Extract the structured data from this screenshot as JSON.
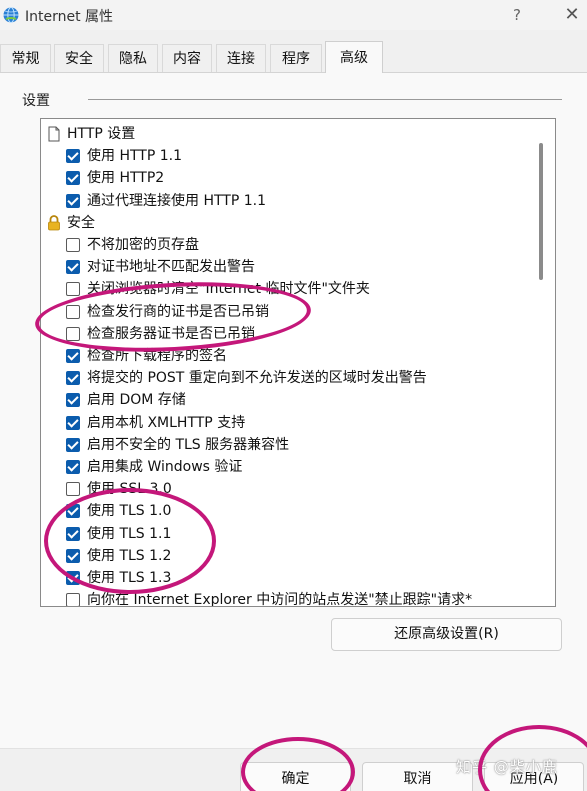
{
  "window": {
    "title": "Internet 属性",
    "help_glyph": "?",
    "close_glyph": "✕",
    "icon": "internet-globe-icon"
  },
  "tabs": [
    {
      "label": "常规"
    },
    {
      "label": "安全"
    },
    {
      "label": "隐私"
    },
    {
      "label": "内容"
    },
    {
      "label": "连接"
    },
    {
      "label": "程序"
    },
    {
      "label": "高级",
      "active": true
    }
  ],
  "settings_group": {
    "label": "设置"
  },
  "settings": [
    {
      "type": "category",
      "icon": "document-icon",
      "label": "HTTP 设置"
    },
    {
      "type": "checkbox",
      "checked": true,
      "label": "使用 HTTP 1.1"
    },
    {
      "type": "checkbox",
      "checked": true,
      "label": "使用 HTTP2"
    },
    {
      "type": "checkbox",
      "checked": true,
      "label": "通过代理连接使用 HTTP 1.1"
    },
    {
      "type": "category",
      "icon": "lock-icon",
      "label": "安全"
    },
    {
      "type": "checkbox",
      "checked": false,
      "label": "不将加密的页存盘"
    },
    {
      "type": "checkbox",
      "checked": true,
      "label": "对证书地址不匹配发出警告"
    },
    {
      "type": "checkbox",
      "checked": false,
      "label": "关闭浏览器时清空\"Internet 临时文件\"文件夹"
    },
    {
      "type": "checkbox",
      "checked": false,
      "label": "检查发行商的证书是否已吊销"
    },
    {
      "type": "checkbox",
      "checked": false,
      "label": "检查服务器证书是否已吊销"
    },
    {
      "type": "checkbox",
      "checked": true,
      "label": "检查所下载程序的签名"
    },
    {
      "type": "checkbox",
      "checked": true,
      "label": "将提交的 POST 重定向到不允许发送的区域时发出警告"
    },
    {
      "type": "checkbox",
      "checked": true,
      "label": "启用 DOM 存储"
    },
    {
      "type": "checkbox",
      "checked": true,
      "label": "启用本机 XMLHTTP 支持"
    },
    {
      "type": "checkbox",
      "checked": true,
      "label": "启用不安全的 TLS 服务器兼容性"
    },
    {
      "type": "checkbox",
      "checked": true,
      "label": "启用集成 Windows 验证"
    },
    {
      "type": "checkbox",
      "checked": false,
      "label": "使用 SSL 3.0"
    },
    {
      "type": "checkbox",
      "checked": true,
      "label": "使用 TLS 1.0"
    },
    {
      "type": "checkbox",
      "checked": true,
      "label": "使用 TLS 1.1"
    },
    {
      "type": "checkbox",
      "checked": true,
      "label": "使用 TLS 1.2"
    },
    {
      "type": "checkbox",
      "checked": true,
      "label": "使用 TLS 1.3"
    },
    {
      "type": "checkbox",
      "checked": false,
      "label": "向你在 Internet Explorer 中访问的站点发送\"禁止跟踪\"请求*"
    }
  ],
  "restore_button": {
    "label": "还原高级设置(R)"
  },
  "footer": {
    "ok_label": "确定",
    "cancel_label": "取消",
    "apply_label": "应用(A)"
  },
  "watermark": {
    "text": "知乎 @柴小鹿"
  },
  "colors": {
    "checkbox_checked": "#0b5cad",
    "annotation": "#c4177a"
  }
}
